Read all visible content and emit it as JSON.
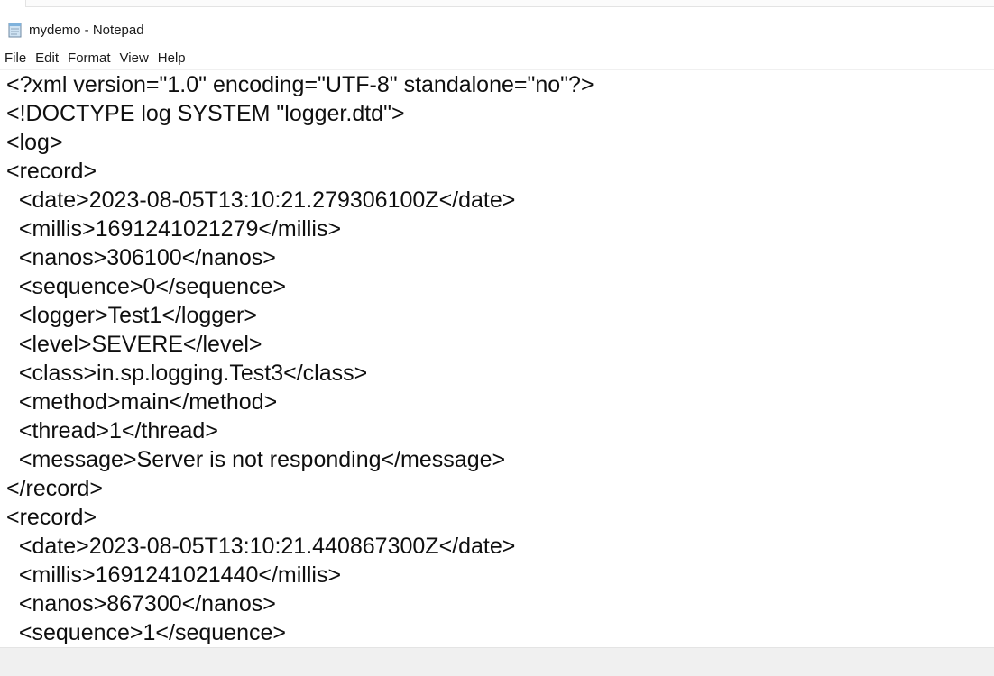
{
  "window": {
    "title": "mydemo - Notepad",
    "icon": "notepad-icon"
  },
  "menu": {
    "file": "File",
    "edit": "Edit",
    "format": "Format",
    "view": "View",
    "help": "Help"
  },
  "editor": {
    "lines": [
      "<?xml version=\"1.0\" encoding=\"UTF-8\" standalone=\"no\"?>",
      "<!DOCTYPE log SYSTEM \"logger.dtd\">",
      "<log>",
      "<record>",
      "  <date>2023-08-05T13:10:21.279306100Z</date>",
      "  <millis>1691241021279</millis>",
      "  <nanos>306100</nanos>",
      "  <sequence>0</sequence>",
      "  <logger>Test1</logger>",
      "  <level>SEVERE</level>",
      "  <class>in.sp.logging.Test3</class>",
      "  <method>main</method>",
      "  <thread>1</thread>",
      "  <message>Server is not responding</message>",
      "</record>",
      "<record>",
      "  <date>2023-08-05T13:10:21.440867300Z</date>",
      "  <millis>1691241021440</millis>",
      "  <nanos>867300</nanos>",
      "  <sequence>1</sequence>"
    ]
  }
}
